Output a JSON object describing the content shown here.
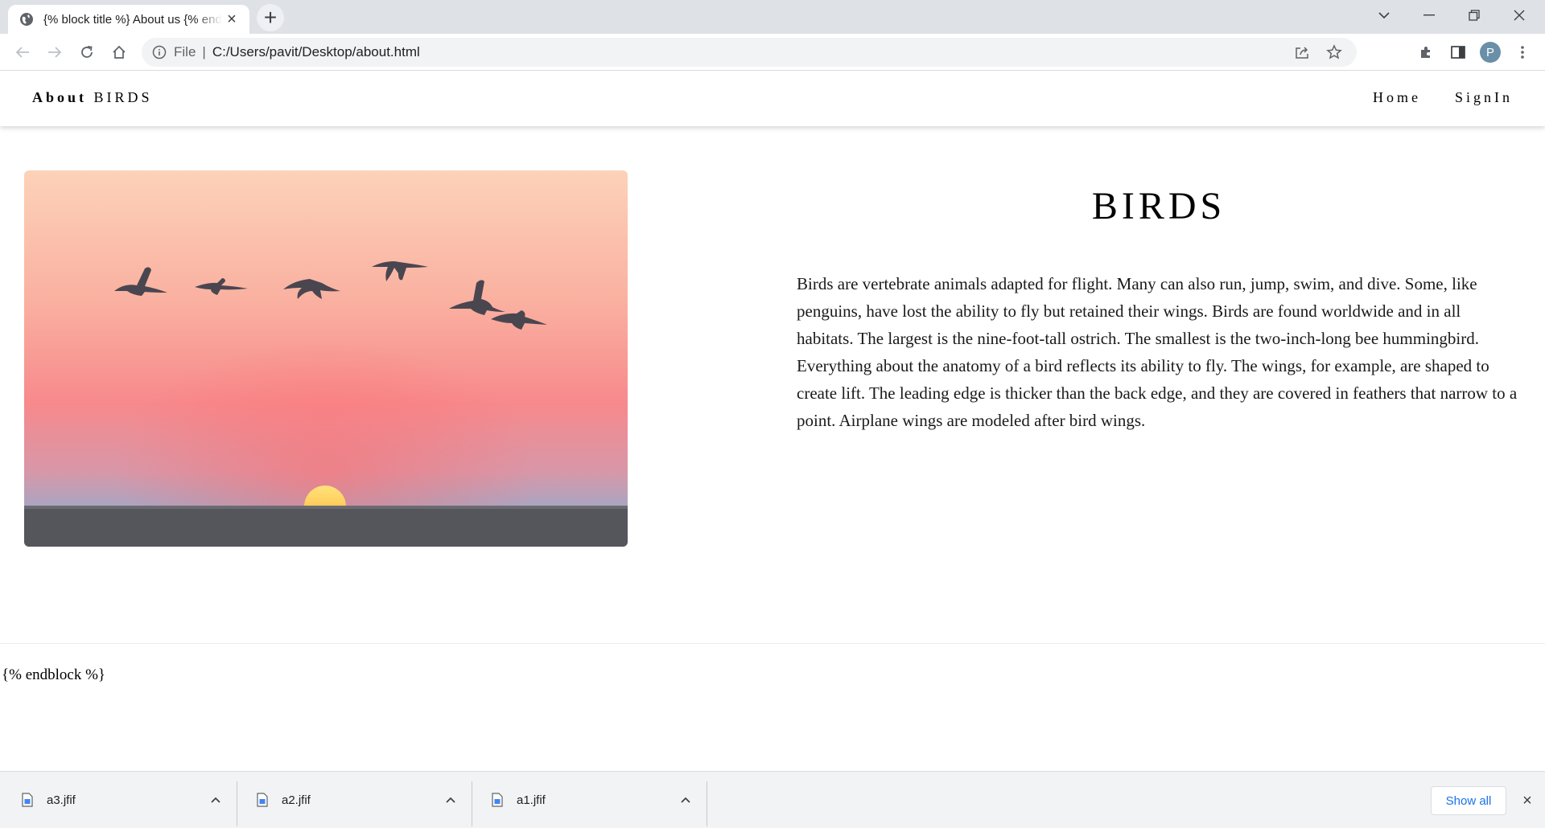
{
  "browser": {
    "tab": {
      "title": "{% block title %} About us {% endblock %}"
    },
    "omnibox": {
      "scheme": "File",
      "separator": "|",
      "url": "C:/Users/pavit/Desktop/about.html"
    },
    "profile_initial": "P"
  },
  "site": {
    "brand": {
      "bold": "About",
      "rest": "BIRDS"
    },
    "nav": [
      {
        "label": "Home"
      },
      {
        "label": "SignIn"
      }
    ]
  },
  "main": {
    "heading": "BIRDS",
    "paragraph": "Birds are vertebrate animals adapted for flight. Many can also run, jump, swim, and dive. Some, like penguins, have lost the ability to fly but retained their wings. Birds are found worldwide and in all habitats. The largest is the nine-foot-tall ostrich. The smallest is the two-inch-long bee hummingbird. Everything about the anatomy of a bird reflects its ability to fly. The wings, for example, are shaped to create lift. The leading edge is thicker than the back edge, and they are covered in feathers that narrow to a point. Airplane wings are modeled after bird wings."
  },
  "footer_text": "{% endblock %}",
  "downloads": {
    "items": [
      {
        "name": "a3.jfif"
      },
      {
        "name": "a2.jfif"
      },
      {
        "name": "a1.jfif"
      }
    ],
    "show_all_label": "Show all"
  },
  "colors": {
    "accent_blue": "#1a73e8",
    "sky_top": "#fcd2b8",
    "sky_mid": "#f78a8a",
    "sun": "#ffd23f",
    "ground": "#52535a"
  }
}
